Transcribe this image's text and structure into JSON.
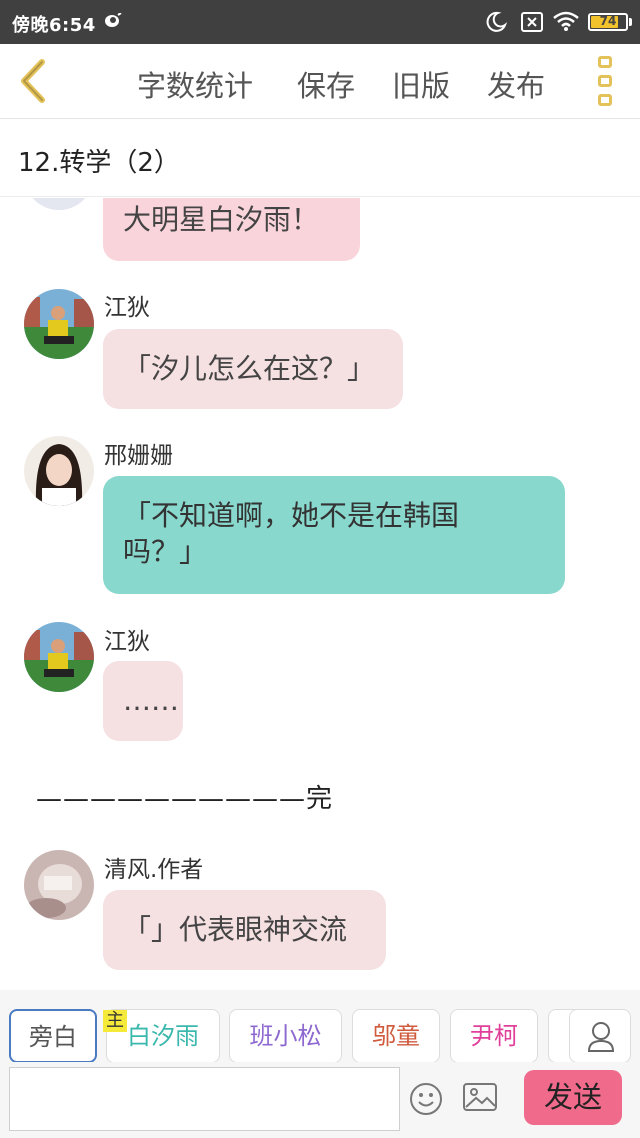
{
  "status_bar": {
    "time": "傍晚6:54",
    "battery": "74",
    "battery_level": 0.74
  },
  "toolbar": {
    "word_count": "字数统计",
    "save": "保存",
    "old_version": "旧版",
    "publish": "发布"
  },
  "chapter": {
    "title": "12.转学（2）"
  },
  "messages": [
    {
      "speaker": "",
      "text": "大明星白汐雨！"
    },
    {
      "speaker": "江狄",
      "text": "「汐儿怎么在这？」"
    },
    {
      "speaker": "邢姗姗",
      "text_line1": "「不知道啊，她不是在韩国",
      "text_line2": "吗？」"
    },
    {
      "speaker": "江狄",
      "text": "……"
    },
    {
      "narration": "——————————完"
    },
    {
      "speaker": "清风.作者",
      "text": "「」代表眼神交流"
    }
  ],
  "characters": {
    "narrator": "旁白",
    "main_tag": "主",
    "list": [
      {
        "name": "白汐雨",
        "color": "#3bb8ad"
      },
      {
        "name": "班小松",
        "color": "#8e6ad0"
      },
      {
        "name": "邬童",
        "color": "#d05a3c"
      },
      {
        "name": "尹柯",
        "color": "#e0409a"
      }
    ]
  },
  "input": {
    "value": "",
    "placeholder": "",
    "send": "发送"
  },
  "colors": {
    "accent_gold": "#e4c25a",
    "send_pink": "#f06a8c",
    "bubble_teal": "#89d8cd",
    "bubble_pink": "#f5e0e2"
  }
}
